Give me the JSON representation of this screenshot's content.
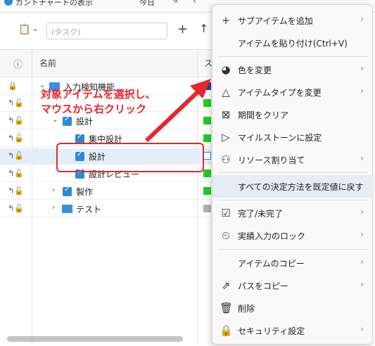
{
  "toolbar": {
    "gantt_label": "ガントチャートの表示",
    "today_label": "今日",
    "task_placeholder": "(タスク)"
  },
  "grid": {
    "col_info": "ⓘ",
    "col_name": "名前",
    "col_status": "ス",
    "rows": [
      {
        "label": "入力検知機能",
        "color": "#2c3e8f"
      },
      {
        "label": "",
        "color": "#22cc22"
      },
      {
        "label": "設計",
        "color": "#22cc22"
      },
      {
        "label": "集中設計",
        "color": "#22cc22"
      },
      {
        "label": "設計",
        "color": "#ffffff"
      },
      {
        "label": "設計レビュー",
        "color": "#22cc22"
      },
      {
        "label": "製作",
        "color": "#22cc22"
      },
      {
        "label": "テスト",
        "color": "#b0b0b0"
      }
    ]
  },
  "annotation": {
    "line1": "対象アイテムを選択し、",
    "line2": "マウスから右クリック"
  },
  "menu": {
    "items": [
      {
        "label": "サブアイテムを追加",
        "icon": "plus-icon",
        "arrow": true
      },
      {
        "label": "アイテムを貼り付け(Ctrl+V)",
        "icon": "",
        "arrow": false
      },
      {
        "label": "色を変更",
        "icon": "palette-icon",
        "arrow": true
      },
      {
        "label": "アイテムタイプを変更",
        "icon": "shapes-icon",
        "arrow": true
      },
      {
        "label": "期間をクリア",
        "icon": "calendar-x-icon",
        "arrow": false
      },
      {
        "label": "マイルストーンに設定",
        "icon": "flag-icon",
        "arrow": false
      },
      {
        "label": "リソース割り当て",
        "icon": "person-add-icon",
        "arrow": true
      },
      {
        "label": "すべての決定方法を既定値に戻す",
        "icon": "",
        "arrow": false
      },
      {
        "label": "完了/未完了",
        "icon": "checkbox-icon",
        "arrow": true
      },
      {
        "label": "実績入力のロック",
        "icon": "lock-clock-icon",
        "arrow": true
      },
      {
        "label": "アイテムのコピー",
        "icon": "",
        "arrow": true
      },
      {
        "label": "パスをコピー",
        "icon": "share-icon",
        "arrow": true
      },
      {
        "label": "削除",
        "icon": "trash-icon",
        "arrow": false
      },
      {
        "label": "セキュリティ設定",
        "icon": "lock-icon",
        "arrow": true
      }
    ]
  }
}
